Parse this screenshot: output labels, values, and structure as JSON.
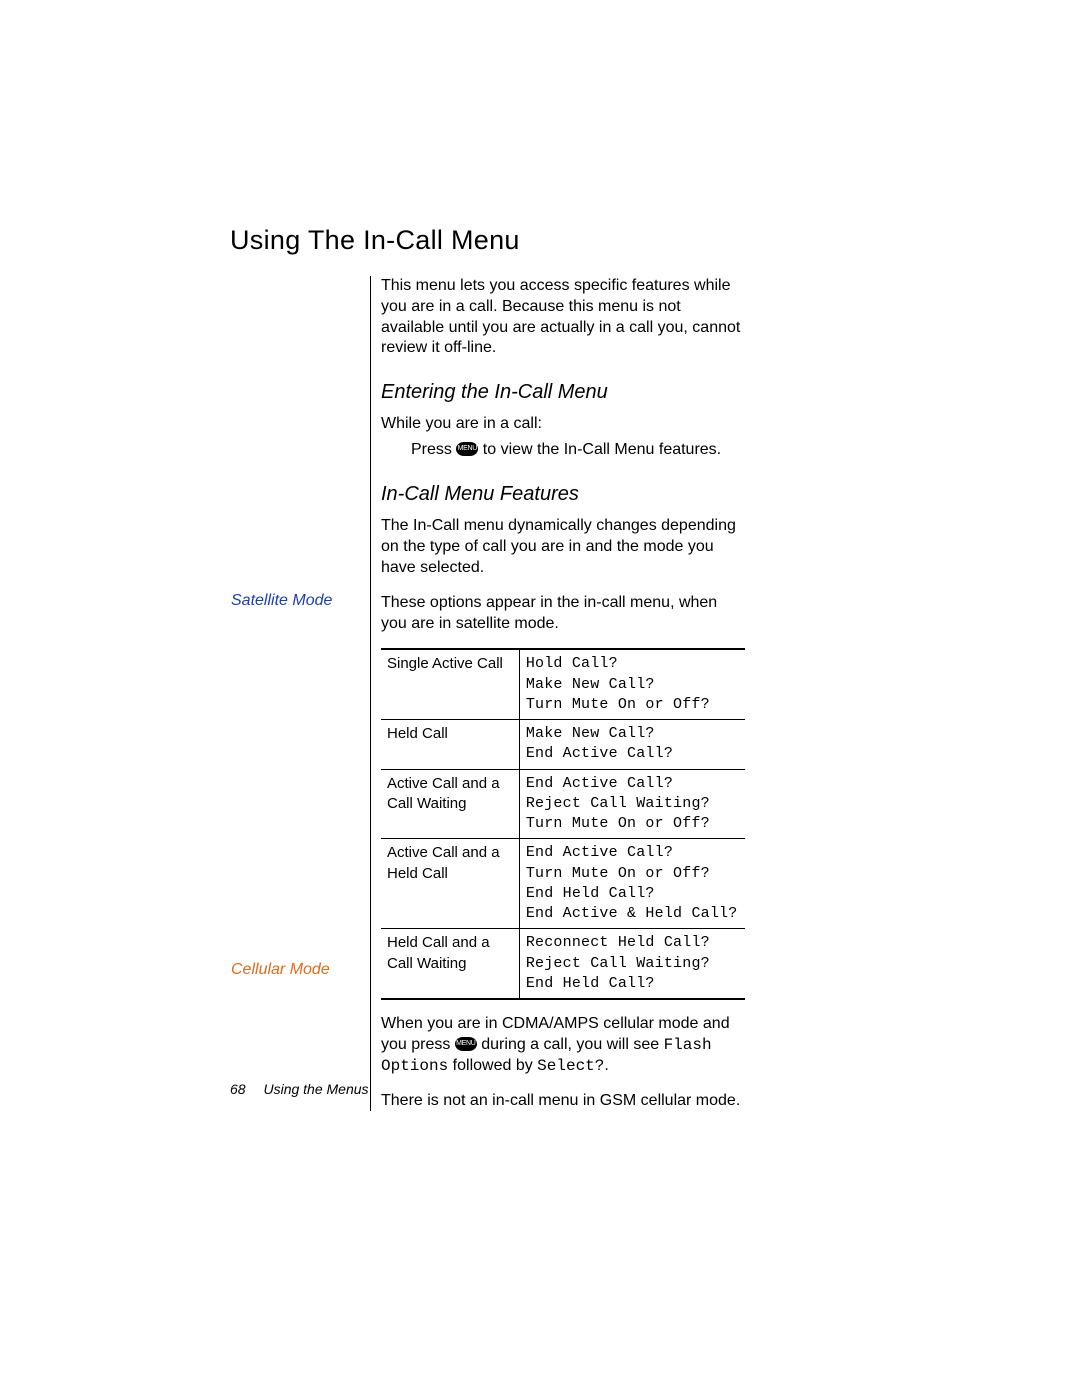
{
  "title": "Using The In-Call Menu",
  "intro": "This menu lets you access speciﬁc features while you are in a call. Because this menu is not available until you are actually in a call you, cannot review it off-line.",
  "entering": {
    "heading": "Entering the In-Call Menu",
    "lead": "While you are in a call:",
    "step_before": "Press ",
    "step_after": " to view the In-Call Menu features."
  },
  "features": {
    "heading": "In-Call Menu Features",
    "lead": "The In-Call menu dynamically changes depending on the type of call you are in and the mode you have selected."
  },
  "satellite": {
    "label": "Satellite Mode",
    "lead": "These options appear in the in-call menu, when you are in satellite mode.",
    "rows": [
      {
        "state": "Single Active Call",
        "opts": "Hold Call?\nMake New Call?\nTurn Mute On or Off?"
      },
      {
        "state": "Held Call",
        "opts": "Make New Call?\nEnd Active Call?"
      },
      {
        "state": "Active Call and a Call Waiting",
        "opts": "End Active Call?\nReject Call Waiting?\nTurn Mute On or Off?"
      },
      {
        "state": "Active Call and a Held Call",
        "opts": "End Active Call?\nTurn Mute On or Off?\nEnd Held Call?\nEnd Active & Held Call?"
      },
      {
        "state": "Held Call and a Call Waiting",
        "opts": "Reconnect Held Call?\nReject Call Waiting?\nEnd Held Call?"
      }
    ]
  },
  "cellular": {
    "label": "Cellular Mode",
    "p1_a": "When you are in CDMA/AMPS cellular mode and you press ",
    "p1_b": " during a call, you will see ",
    "p1_mono1": "Flash Options",
    "p1_c": " followed by ",
    "p1_mono2": "Select?",
    "p1_d": ".",
    "p2": "There is not an in-call menu in GSM cellular mode."
  },
  "footer": {
    "page": "68",
    "section": "Using the Menus"
  },
  "icon_text": "MENU"
}
